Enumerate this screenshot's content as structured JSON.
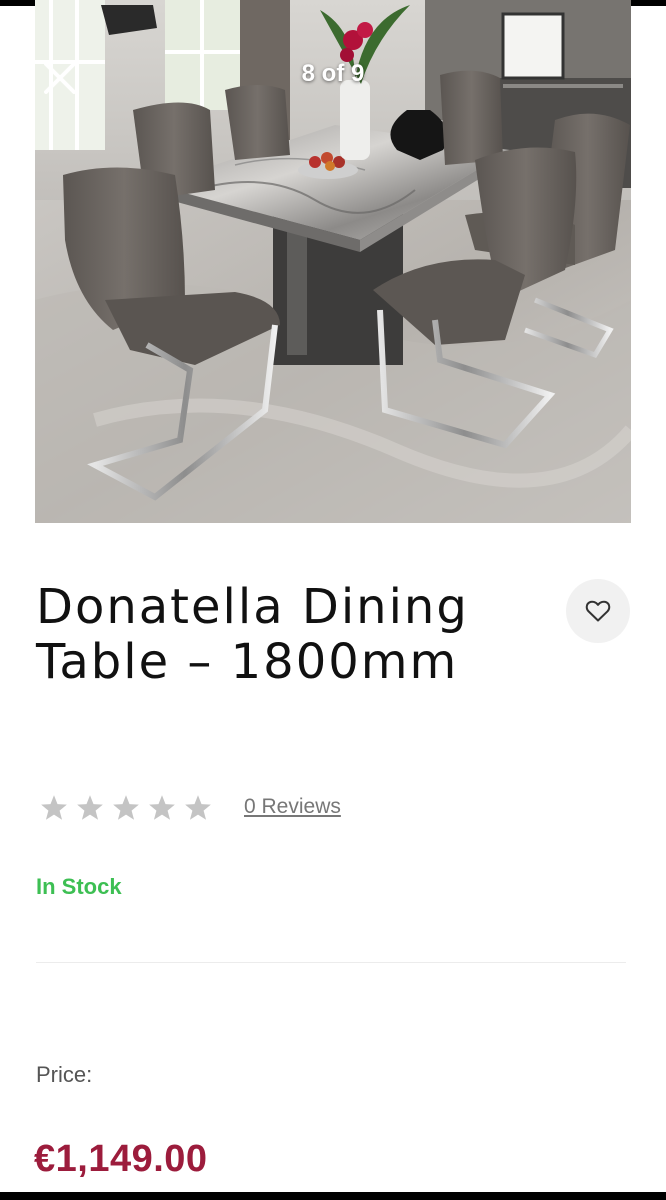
{
  "gallery": {
    "counter": "8 of 9",
    "close_icon": "close-icon",
    "image_alt": "Donatella dining table with six grey chairs"
  },
  "product": {
    "title": "Donatella Dining Table – 1800mm",
    "wishlist_icon": "heart-outline-icon",
    "rating": {
      "stars_filled": 0,
      "stars_total": 5,
      "reviews_label": "0 Reviews"
    },
    "stock_status": "In Stock",
    "price_label": "Price:",
    "price": "€1,149.00"
  },
  "colors": {
    "in_stock": "#3dbf53",
    "price": "#9c1c3c",
    "star_empty": "#c4c4c4"
  }
}
